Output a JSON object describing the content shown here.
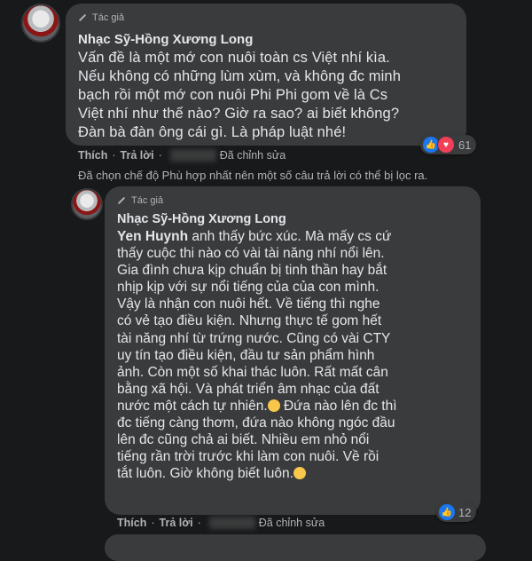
{
  "comments": [
    {
      "author_badge": "Tác giả",
      "author": "Nhạc Sỹ-Hồng Xương Long",
      "mention": "",
      "text": "Vấn đề là một mớ con nuôi toàn cs Việt nhí kìa.\nNếu không có những lùm xùm, và không đc minh\nbạch rồi một mớ con nuôi Phi Phi gom về là Cs\nViệt nhí như thế nào? Giờ ra sao? ai biết không?\nĐàn bà đàn ông cái gì. Là pháp luật nhé!",
      "reaction_count": "61",
      "actions": {
        "like": "Thích",
        "reply": "Trả lời",
        "edited": "Đã chỉnh sửa"
      },
      "icons": [
        "pen-icon",
        "like-icon",
        "love-icon"
      ]
    },
    {
      "author_badge": "Tác giả",
      "author": "Nhạc Sỹ-Hồng Xương Long",
      "mention": "Yen Huynh",
      "text": " anh thấy bức xúc. Mà mấy cs cứ\nthấy cuộc thi nào có vài tài năng nhí nổi lên.\nGia đình chưa kịp chuẩn bị tinh thần hay bắt\nnhịp kịp với sự nổi tiếng của của con mình.\nVậy là nhận con nuôi hết. Về tiếng thì nghe\ncó vẻ tạo điều kiện. Nhưng thực tế gom hết\ntài năng nhí từ trứng nước. Cũng có vài CTY\nuy tín tạo điều kiện, đầu tư sản phẩm hình\nảnh. Còn một số khai thác luôn. Rất mất cân\nbằng xã hội. Và phát triển âm nhạc của đất\nnước một cách tự nhiên.",
      "text_2": " Đứa nào lên đc thì\nđc tiếng càng thơm, đứa nào không ngóc đầu\nlên đc cũng chả ai biết. Nhiều em nhỏ nổi\ntiếng rần trời trước khi làm con nuôi. Về rồi\ntắt luôn. Giờ không biết luôn.",
      "reaction_count": "12",
      "actions": {
        "like": "Thích",
        "reply": "Trả lời",
        "edited": "Đã chỉnh sửa"
      },
      "icons": [
        "pen-icon",
        "sad-emoji-icon",
        "smile-emoji-icon",
        "like-icon"
      ]
    }
  ],
  "filter_note": "Đã chọn chế độ Phù hợp nhất nên một số câu trả lời có thể bị lọc ra.",
  "colors": {
    "background": "#18191a",
    "bubble": "#3a3b3c",
    "text": "#e4e6eb",
    "muted": "#b0b3b8",
    "like": "#1877f2",
    "love": "#f33e58"
  }
}
